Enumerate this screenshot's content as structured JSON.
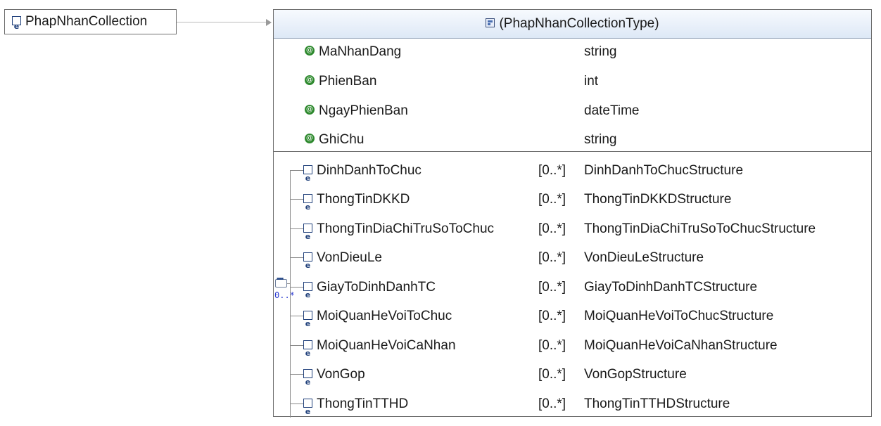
{
  "root": {
    "name": "PhapNhanCollection"
  },
  "type": {
    "header": "(PhapNhanCollectionType)",
    "attributes": [
      {
        "name": "MaNhanDang",
        "type": "string"
      },
      {
        "name": "PhienBan",
        "type": "int"
      },
      {
        "name": "NgayPhienBan",
        "type": "dateTime"
      },
      {
        "name": "GhiChu",
        "type": "string"
      }
    ],
    "sequence": {
      "cardinality": "0..*"
    },
    "elements": [
      {
        "name": "DinhDanhToChuc",
        "card": "[0..*]",
        "type": "DinhDanhToChucStructure"
      },
      {
        "name": "ThongTinDKKD",
        "card": "[0..*]",
        "type": "ThongTinDKKDStructure"
      },
      {
        "name": "ThongTinDiaChiTruSoToChuc",
        "card": "[0..*]",
        "type": "ThongTinDiaChiTruSoToChucStructure"
      },
      {
        "name": "VonDieuLe",
        "card": "[0..*]",
        "type": "VonDieuLeStructure"
      },
      {
        "name": "GiayToDinhDanhTC",
        "card": "[0..*]",
        "type": "GiayToDinhDanhTCStructure"
      },
      {
        "name": "MoiQuanHeVoiToChuc",
        "card": "[0..*]",
        "type": "MoiQuanHeVoiToChucStructure"
      },
      {
        "name": "MoiQuanHeVoiCaNhan",
        "card": "[0..*]",
        "type": "MoiQuanHeVoiCaNhanStructure"
      },
      {
        "name": "VonGop",
        "card": "[0..*]",
        "type": "VonGopStructure"
      },
      {
        "name": "ThongTinTTHD",
        "card": "[0..*]",
        "type": "ThongTinTTHDStructure"
      }
    ]
  }
}
